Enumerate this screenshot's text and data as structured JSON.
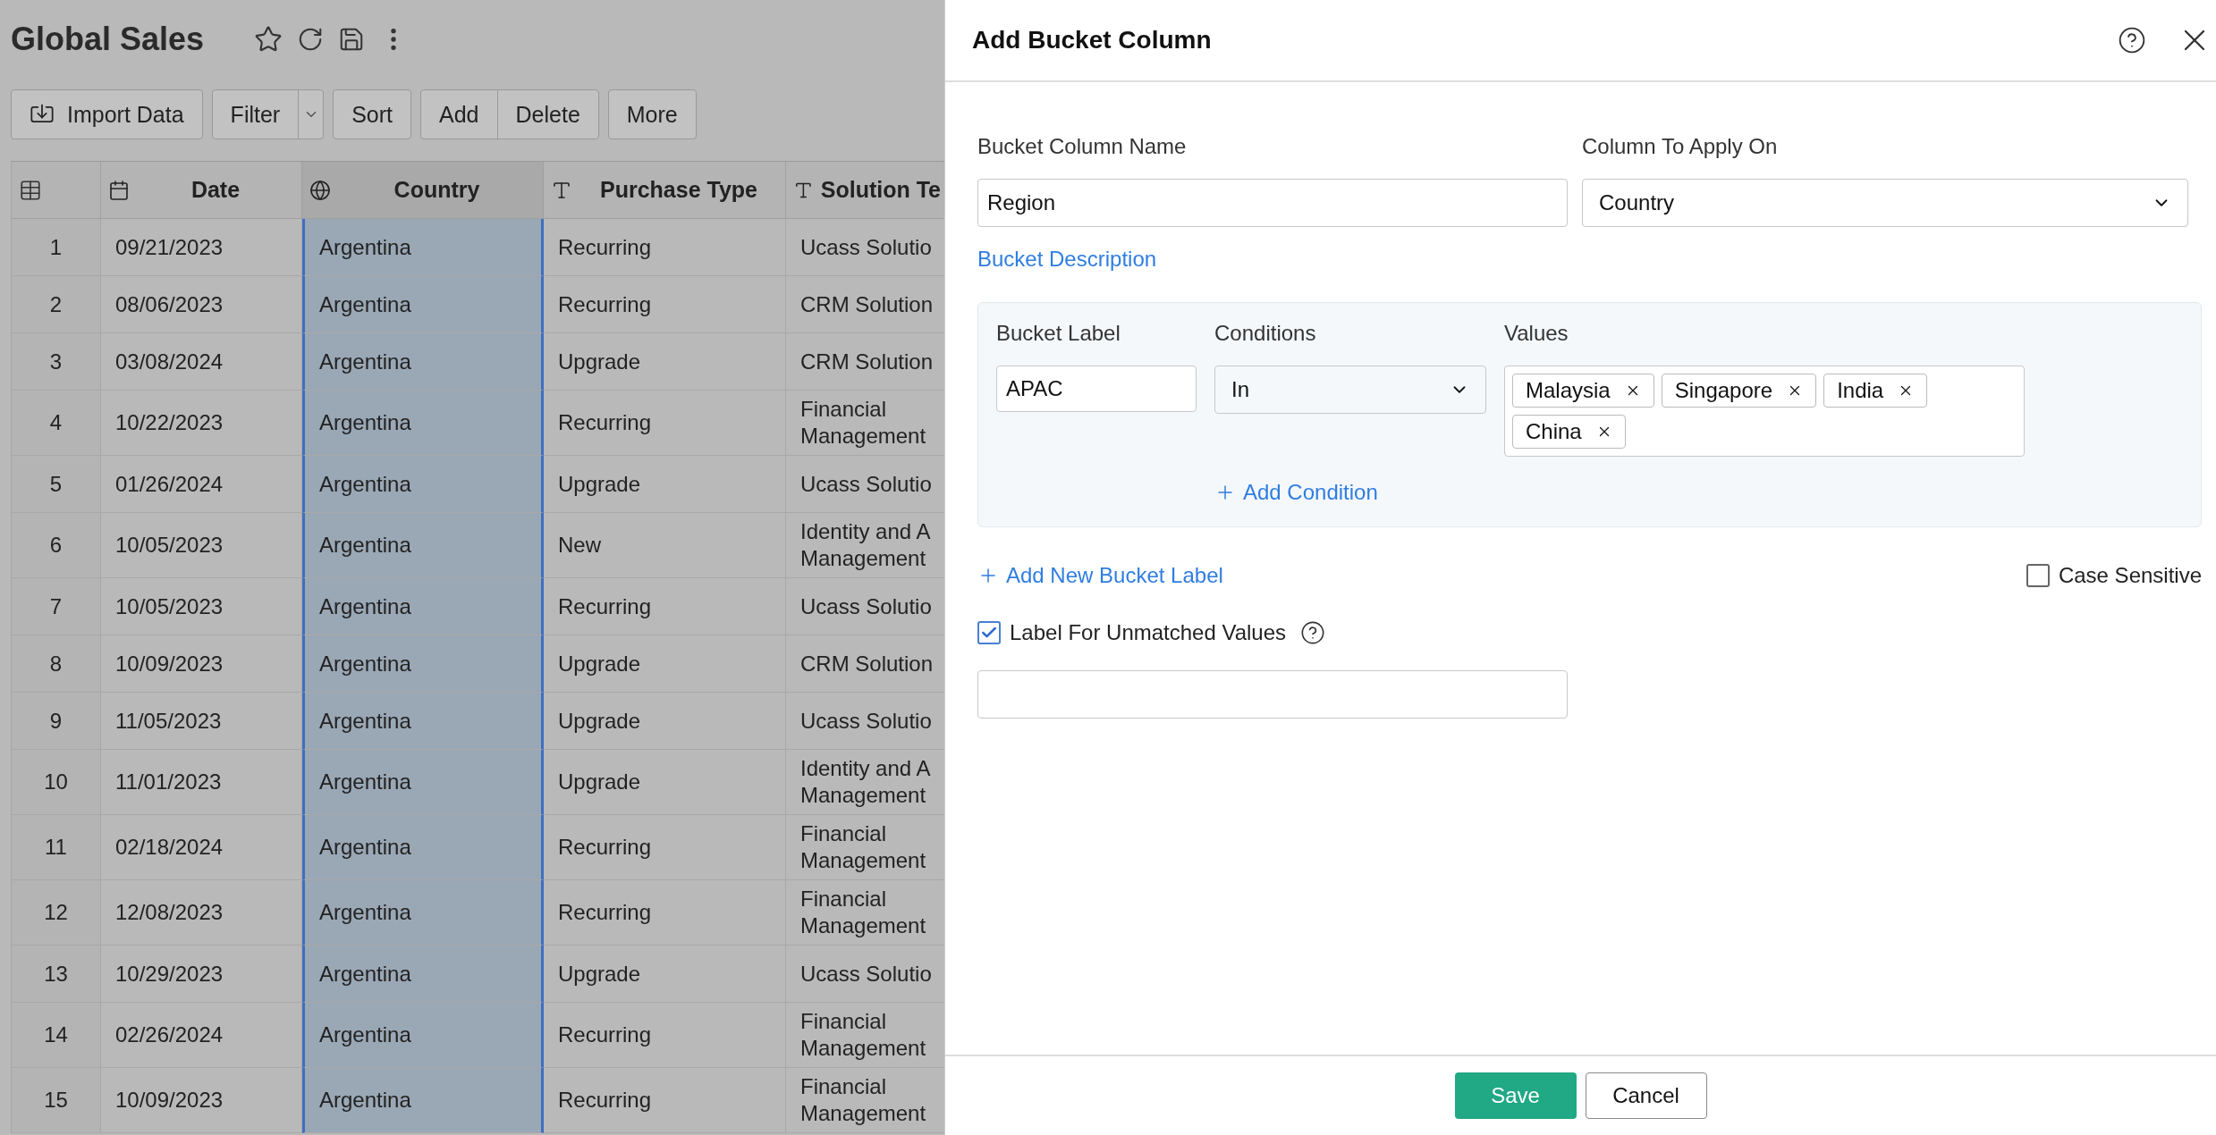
{
  "page": {
    "title": "Global Sales"
  },
  "toolbar": [
    {
      "kind": "import",
      "labels": [
        "Import Data"
      ]
    },
    {
      "kind": "split",
      "labels": [
        "Filter"
      ]
    },
    {
      "kind": "plain",
      "labels": [
        "Sort"
      ]
    },
    {
      "kind": "plain",
      "labels": [
        "Add",
        "Delete"
      ]
    },
    {
      "kind": "plain",
      "labels": [
        "More"
      ]
    }
  ],
  "table": {
    "columns": [
      {
        "label": "Date",
        "kind": "date",
        "selected": false
      },
      {
        "label": "Country",
        "kind": "geo",
        "selected": true
      },
      {
        "label": "Purchase Type",
        "kind": "text",
        "selected": false
      },
      {
        "label": "Solution Te",
        "kind": "text",
        "selected": false
      }
    ],
    "rows": [
      {
        "number": "1",
        "cells": [
          "09/21/2023",
          "Argentina",
          "Recurring",
          "Ucass Solutio"
        ]
      },
      {
        "number": "2",
        "cells": [
          "08/06/2023",
          "Argentina",
          "Recurring",
          "CRM Solution"
        ]
      },
      {
        "number": "3",
        "cells": [
          "03/08/2024",
          "Argentina",
          "Upgrade",
          "CRM Solution"
        ]
      },
      {
        "number": "4",
        "cells": [
          "10/22/2023",
          "Argentina",
          "Recurring",
          "Financial Management"
        ]
      },
      {
        "number": "5",
        "cells": [
          "01/26/2024",
          "Argentina",
          "Upgrade",
          "Ucass Solutio"
        ]
      },
      {
        "number": "6",
        "cells": [
          "10/05/2023",
          "Argentina",
          "New",
          "Identity and A Management"
        ]
      },
      {
        "number": "7",
        "cells": [
          "10/05/2023",
          "Argentina",
          "Recurring",
          "Ucass Solutio"
        ]
      },
      {
        "number": "8",
        "cells": [
          "10/09/2023",
          "Argentina",
          "Upgrade",
          "CRM Solution"
        ]
      },
      {
        "number": "9",
        "cells": [
          "11/05/2023",
          "Argentina",
          "Upgrade",
          "Ucass Solutio"
        ]
      },
      {
        "number": "10",
        "cells": [
          "11/01/2023",
          "Argentina",
          "Upgrade",
          "Identity and A Management"
        ]
      },
      {
        "number": "11",
        "cells": [
          "02/18/2024",
          "Argentina",
          "Recurring",
          "Financial Management"
        ]
      },
      {
        "number": "12",
        "cells": [
          "12/08/2023",
          "Argentina",
          "Recurring",
          "Financial Management"
        ]
      },
      {
        "number": "13",
        "cells": [
          "10/29/2023",
          "Argentina",
          "Upgrade",
          "Ucass Solutio"
        ]
      },
      {
        "number": "14",
        "cells": [
          "02/26/2024",
          "Argentina",
          "Recurring",
          "Financial Management"
        ]
      },
      {
        "number": "15",
        "cells": [
          "10/09/2023",
          "Argentina",
          "Recurring",
          "Financial Management"
        ]
      }
    ]
  },
  "dialog": {
    "title": "Add Bucket Column",
    "name_field": {
      "label": "Bucket Column Name",
      "value": "Region"
    },
    "apply_field": {
      "label": "Column To Apply On",
      "value": "Country"
    },
    "description_link": "Bucket Description",
    "bucket": {
      "label_heading": "Bucket Label",
      "conditions_heading": "Conditions",
      "values_heading": "Values",
      "label_value": "APAC",
      "condition": "In",
      "values": [
        "Malaysia",
        "Singapore",
        "India",
        "China"
      ],
      "add_condition": "Add Condition"
    },
    "add_label": "Add New Bucket Label",
    "case_sensitive": {
      "label": "Case Sensitive",
      "checked": false
    },
    "unmatched": {
      "label": "Label For Unmatched Values",
      "checked": true
    },
    "buttons": [
      {
        "label": "Save",
        "kind": "primary"
      },
      {
        "label": "Cancel",
        "kind": "secondary"
      }
    ]
  }
}
